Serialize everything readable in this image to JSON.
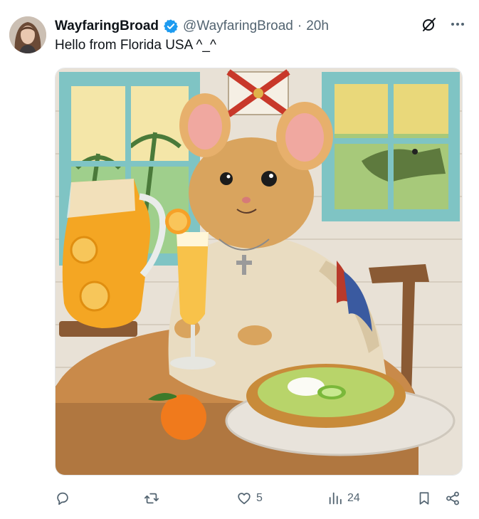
{
  "tweet": {
    "display_name": "WayfaringBroad",
    "handle": "@WayfaringBroad",
    "separator": "·",
    "time": "20h",
    "text": "Hello from Florida USA ^_^",
    "verified": true,
    "image_alt_icon": "florida-kitchen-mouse-illustration"
  },
  "actions": {
    "reply_count": "",
    "repost_count": "",
    "like_count": "5",
    "views_count": "24"
  },
  "icons": [
    "verified-badge-icon",
    "grok-icon",
    "more-icon",
    "reply-icon",
    "repost-icon",
    "like-icon",
    "views-icon",
    "bookmark-icon",
    "share-icon"
  ],
  "colors": {
    "verified_blue": "#1d9bf0",
    "text_primary": "#0f1419",
    "text_secondary": "#536471"
  }
}
